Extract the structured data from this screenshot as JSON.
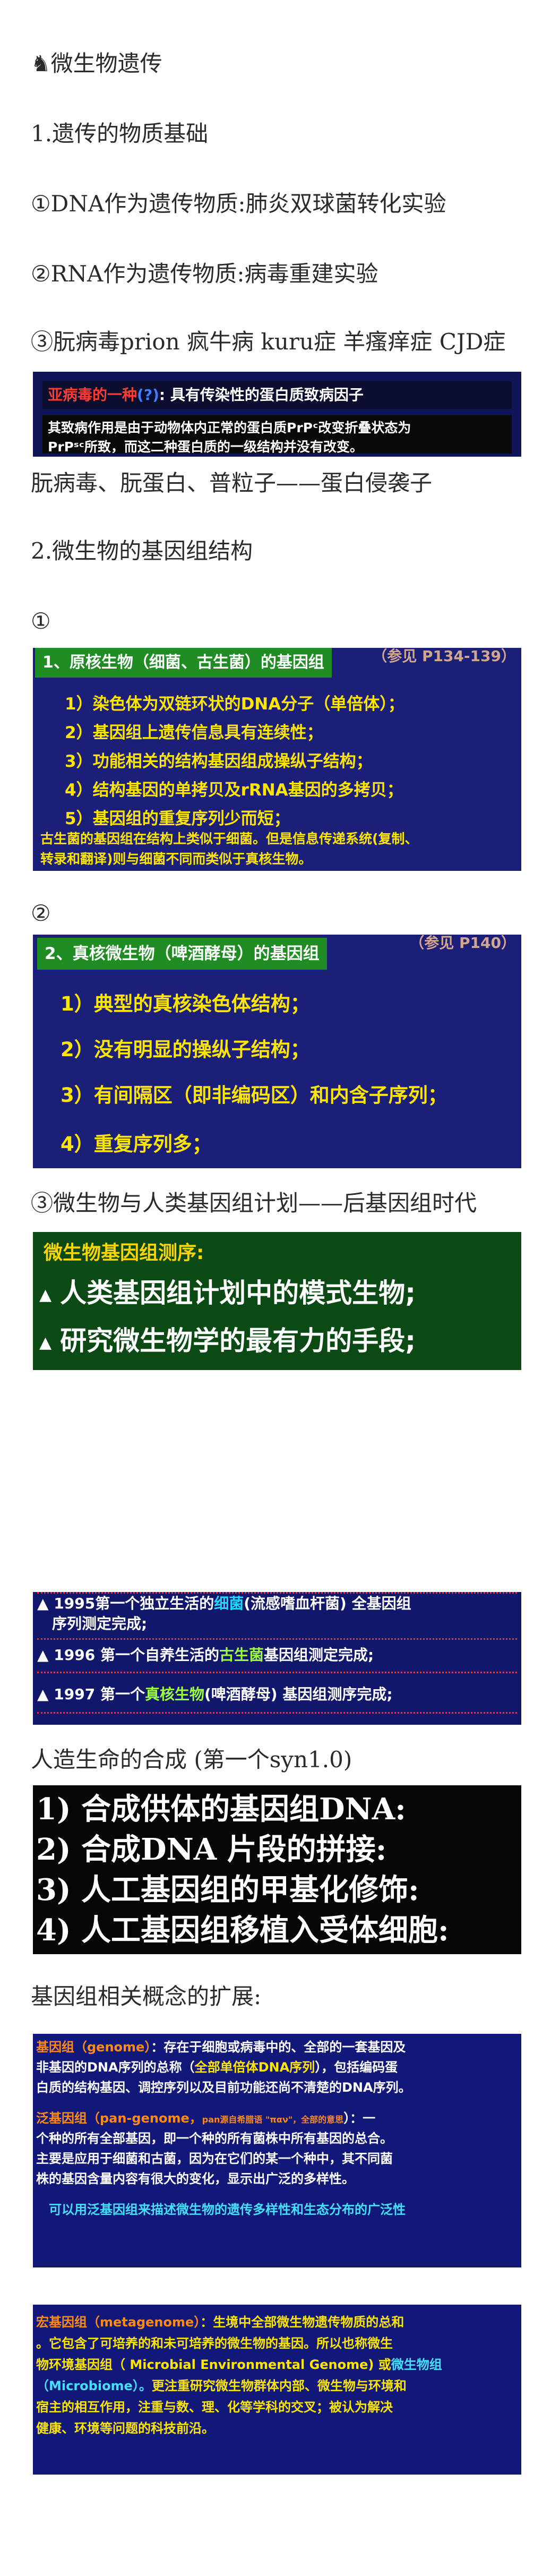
{
  "lines": {
    "title": "♞微生物遗传",
    "l1": "1.遗传的物质基础",
    "l2": "①DNA作为遗传物质:肺炎双球菌转化实验",
    "l3": "②RNA作为遗传物质:病毒重建实验",
    "l4": "③朊病毒prion 疯牛病 kuru症 羊瘙痒症 CJD症",
    "l5": "朊病毒、朊蛋白、普粒子——蛋白侵袭子",
    "l6": "2.微生物的基因组结构",
    "l7": "①",
    "l8": "②",
    "l9": "③微生物与人类基因组计划——后基因组时代",
    "l10": "人造生命的合成 (第一个syn1.0)",
    "l11": "基因组相关概念的扩展:"
  },
  "prion_slide": {
    "title_a": "亚病毒",
    "title_b": "的一种",
    "title_c": "(?)",
    "title_d": ": 具有传染性的蛋白质致病因子",
    "body1": "其致病作用是由于动物体内正常的蛋白质PrPᶜ改变折叠状态为",
    "body2": "PrPˢᶜ所致，而这二种蛋白质的一级结构并没有改变。"
  },
  "prok_slide": {
    "tab": "1、原核生物（细菌、古生菌）的基因组",
    "ghost": "（参见 P134-139）",
    "items": [
      "1）染色体为双链环状的DNA分子（单倍体）；",
      "2）基因组上遗传信息具有连续性；",
      "3）功能相关的结构基因组成操纵子结构；",
      "4）结构基因的单拷贝及rRNA基因的多拷贝；",
      "5）基因组的重复序列少而短；"
    ],
    "note1": "古生菌的基因组在结构上类似于细菌。但是信息传递系统(复制、",
    "note2": "转录和翻译)则与细菌不同而类似于真核生物。"
  },
  "euk_slide": {
    "tab": "2、真核微生物（啤酒酵母）的基因组",
    "ghost": "（参见 P140）",
    "items": [
      "1）典型的真核染色体结构；",
      "2）没有明显的操纵子结构；",
      "3）有间隔区（即非编码区）和内含子序列；",
      "4）重复序列多；"
    ]
  },
  "seq_slide": {
    "title": "微生物基因组测序:",
    "b1": "人类基因组计划中的模式生物;",
    "b2": "研究微生物学的最有力的手段;"
  },
  "genome_slide": {
    "r1a": "1995第一个独立生活的",
    "r1b": "细菌",
    "r1c": "(流感嗜血杆菌) 全基因组",
    "r1d": "序列测定完成;",
    "r2a": "1996  第一个自养生活的",
    "r2b": "古生菌",
    "r2c": "基因组测定完成;",
    "r3a": "1997  第一个",
    "r3b": "真核生物",
    "r3c": "(啤酒酵母) 基因组测序完成;"
  },
  "syn_slide": {
    "s1": "1) 合成供体的基因组DNA:",
    "s2": "2) 合成DNA 片段的拼接:",
    "s3": "3) 人工基因组的甲基化修饰:",
    "s4": "4) 人工基因组移植入受体细胞:"
  },
  "concept1": {
    "a": "基因组（genome）",
    "b": "：存在于细胞或病毒中的、全部的一套基因及",
    "c": "非基因的DNA序列的总称（",
    "d": "全部单倍体DNA序列",
    "e": "），包括编码蛋",
    "f": "白质的结构基因、调控序列以及目前功能还尚不清楚的DNA序列。",
    "g": "泛基因组（pan-genome，",
    "h": "pan源自希腊语 \"παν\"，全部的意思",
    "i": "）：一",
    "j": "个种的所有全部基因，即一个种的所有菌株中所有基因的总合。",
    "k": "主要是应用于细菌和古菌，因为在它们的某一个种中，其不同菌",
    "l": "株的基因含量内容有很大的变化，显示出广泛的多样性。",
    "m": "可以用泛基因组来描述微生物的遗传多样性和生态分布的广泛性"
  },
  "concept2": {
    "a": "宏基因组（metagenome）",
    "b": "：生境中全部微生物遗传物质的总和",
    "c": "。它包含了可培养的和未可培养的微生物的基因。所以也称微生",
    "d": "物环境基因组（ Microbial Environmental Genome) 或",
    "e": "微生物组",
    "f": "（Microbiome）。",
    "g": "更注重研究微生物群体内部、微生物与环境和",
    "h": "宿主的相互作用，注重与数、理、化等学科的交叉；被认为解决",
    "i": "健康、环境等问题的科技前沿。"
  },
  "colors": {
    "navy": "#1b1f78",
    "green_tab": "#1f8c24",
    "yellow": "#ffe600",
    "orange": "#ff8a1a"
  }
}
